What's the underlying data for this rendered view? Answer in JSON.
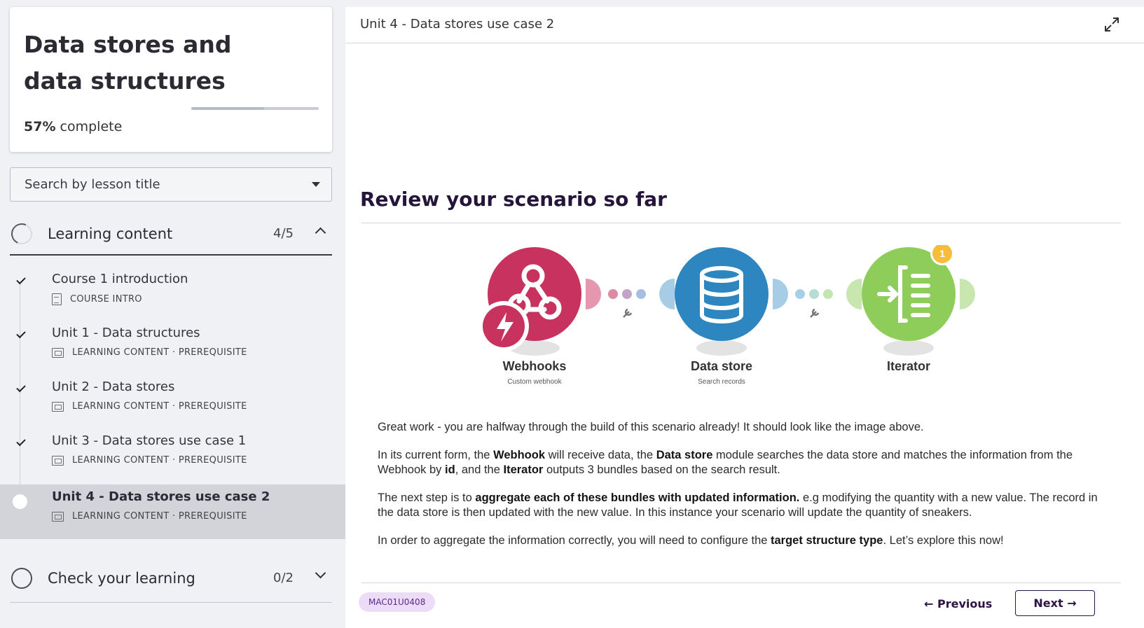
{
  "course": {
    "title": "Data stores and data structures",
    "progress_percent": "57%",
    "progress_suffix": " complete",
    "progress_value": 0.57
  },
  "search": {
    "placeholder": "Search by lesson title"
  },
  "sections": [
    {
      "title": "Learning content",
      "count": "4/5"
    },
    {
      "title": "Check your learning",
      "count": "0/2"
    }
  ],
  "lessons": [
    {
      "title": "Course 1 introduction",
      "meta": "COURSE INTRO",
      "status": "done"
    },
    {
      "title": "Unit 1 - Data structures",
      "meta": "LEARNING CONTENT · PREREQUISITE",
      "status": "done"
    },
    {
      "title": "Unit 2 - Data stores",
      "meta": "LEARNING CONTENT · PREREQUISITE",
      "status": "done"
    },
    {
      "title": "Unit 3 - Data stores use case 1",
      "meta": "LEARNING CONTENT · PREREQUISITE",
      "status": "done"
    },
    {
      "title": "Unit 4 - Data stores use case 2",
      "meta": "LEARNING CONTENT · PREREQUISITE",
      "status": "active"
    }
  ],
  "main": {
    "header_title": "Unit 4 - Data stores use case 2",
    "heading": "Review your scenario so far",
    "modules": [
      {
        "name": "Webhooks",
        "sub": "Custom webhook",
        "color": "#c8325e"
      },
      {
        "name": "Data store",
        "sub": "Search records",
        "color": "#2d86c0"
      },
      {
        "name": "Iterator",
        "sub": "",
        "color": "#8fcd5b",
        "badge": "1"
      }
    ],
    "paragraphs": {
      "p1": "Great work - you are halfway through the build of this scenario already! It should look like the image above.",
      "p2_a": "In its current form, the ",
      "p2_b": "Webhook",
      "p2_c": " will receive data, the ",
      "p2_d": "Data store",
      "p2_e": " module searches the data store and matches the information from the Webhook by ",
      "p2_f": "id",
      "p2_g": ", and the ",
      "p2_h": "Iterator",
      "p2_i": " outputs 3 bundles based on the search result.",
      "p3_a": "The next step is to ",
      "p3_b": "aggregate each of these bundles with updated information.",
      "p3_c": " e.g modifying the quantity with a new value. The record in the data store is then updated with the new value. In this instance your scenario will update the quantity of sneakers.",
      "p4_a": "In order to aggregate the information correctly, you will need to configure the ",
      "p4_b": "target structure type",
      "p4_c": ". Let’s explore this now!"
    },
    "course_code": "MAC01U0408",
    "prev_label": "← Previous",
    "next_label": "Next →"
  }
}
